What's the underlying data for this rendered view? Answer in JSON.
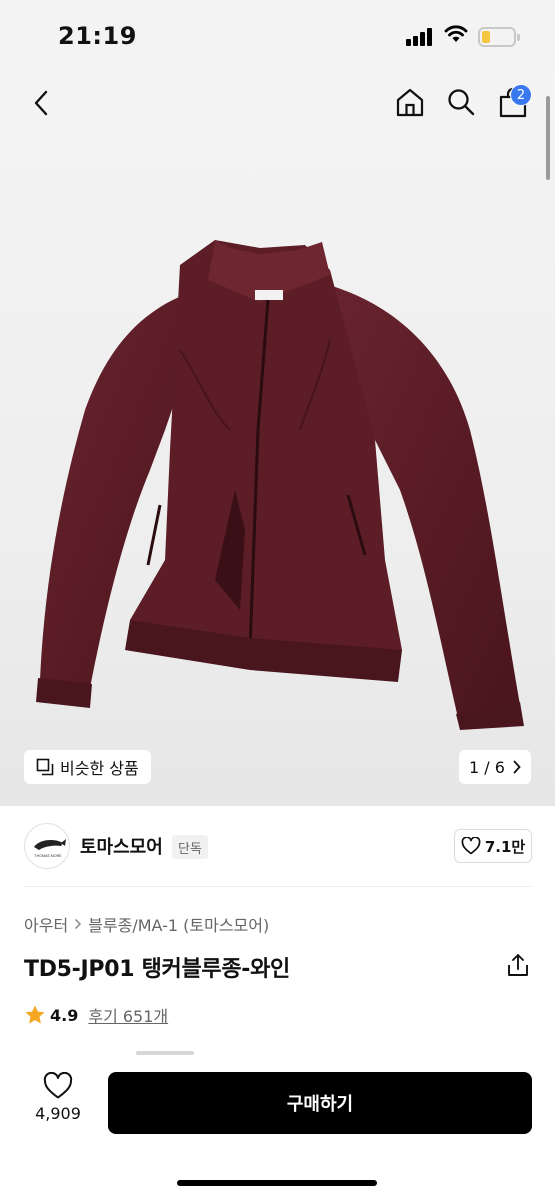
{
  "status_bar": {
    "time": "21:19"
  },
  "header": {
    "cart_count": "2"
  },
  "gallery": {
    "similar_label": "비슷한 상품",
    "page_current": "1",
    "page_separator": "/",
    "page_total": "6"
  },
  "brand": {
    "name": "토마스모어",
    "tag": "단독",
    "likes": "7.1만",
    "logo_text": "THOMAS MORE"
  },
  "product": {
    "breadcrumb": [
      "아우터",
      "블루종/MA-1 (토마스모어)"
    ],
    "title": "TD5-JP01 탱커블루종-와인",
    "rating": "4.9",
    "reviews": "후기 651개"
  },
  "bottom": {
    "wish_count": "4,909",
    "buy_label": "구매하기"
  },
  "colors": {
    "accent": "#3a78f2",
    "star": "#f5a623",
    "jacket": "#5e1f27"
  }
}
